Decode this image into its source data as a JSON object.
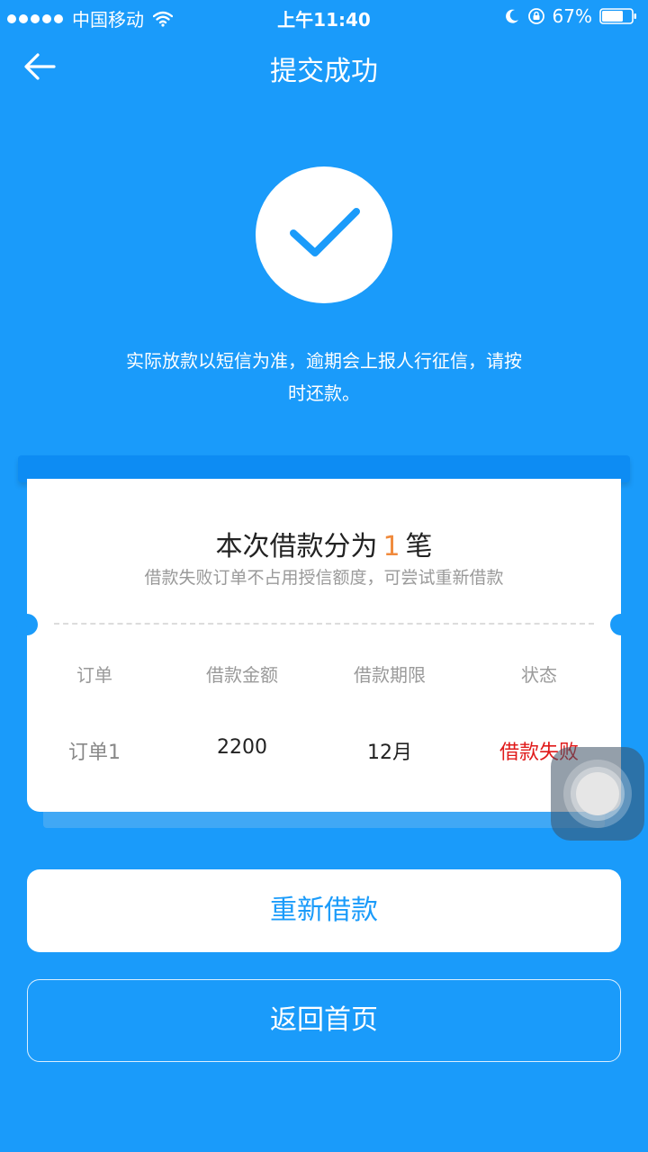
{
  "status_bar": {
    "carrier": "中国移动",
    "time": "上午11:40",
    "battery": "67%"
  },
  "nav": {
    "title": "提交成功"
  },
  "success": {
    "notice_line1": "实际放款以短信为准，逾期会上报人行征信，请按",
    "notice_line2": "时还款。"
  },
  "ticket": {
    "heading_prefix": "本次借款分为",
    "count": "1",
    "heading_suffix": "笔",
    "subtitle": "借款失败订单不占用授信额度，可尝试重新借款",
    "columns": [
      "订单",
      "借款金额",
      "借款期限",
      "状态"
    ],
    "rows": [
      {
        "order": "订单1",
        "amount": "2200",
        "term": "12月",
        "status": "借款失败"
      }
    ]
  },
  "buttons": {
    "retry": "重新借款",
    "home": "返回首页"
  },
  "colors": {
    "background": "#1a9bfa",
    "accent_orange": "#f08a3c",
    "fail_red": "#e01a1a"
  }
}
